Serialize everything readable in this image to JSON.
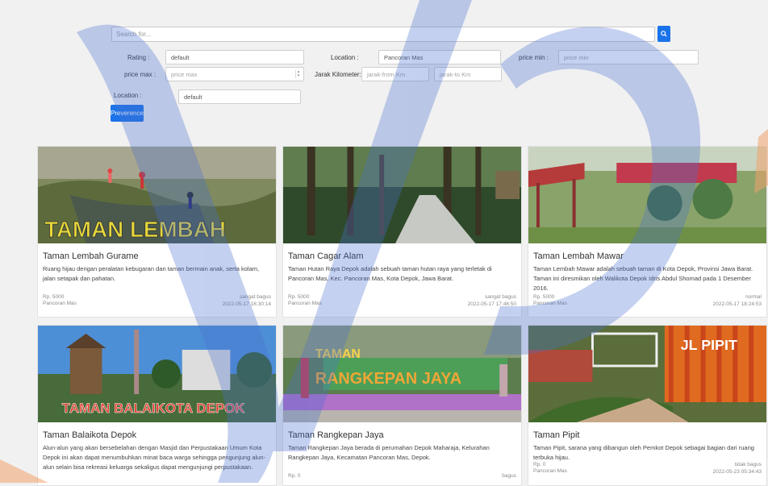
{
  "search": {
    "placeholder": "Search for..."
  },
  "filters": {
    "rating_label": "Rating :",
    "rating_value": "default",
    "location_label": "Location :",
    "location_value": "Pancoran Mas",
    "price_min_label": "price min :",
    "price_min_placeholder": "price min",
    "price_max_label": "price max :",
    "price_max_placeholder": "price max",
    "jarak_label": "Jarak Kilometer:",
    "jarak_from_placeholder": "jarak-from Km",
    "jarak_to_placeholder": "jarak-to Km",
    "location2_label": "Location :",
    "location2_value": "default",
    "preverence_label": "Preverence"
  },
  "cards": [
    {
      "title": "Taman Lembah Gurame",
      "desc": "Ruang hijau dengan peralatan kebugaran dan taman bermain anak, serta kolam, jalan setapak dan pahatan.",
      "price": "Rp. 5000",
      "location": "Pancoran Mas",
      "rating": "sangat bagus",
      "date": "2022-05-17 16:30:14",
      "photo_text": "TAMAN LEMBAH"
    },
    {
      "title": "Taman Cagar Alam",
      "desc": "Taman Hutan Raya Depok adalah sebuah taman hutan raya yang terletak di Pancoran Mas, Kec. Pancoran Mas, Kota Depok, Jawa Barat.",
      "price": "Rp. 5000",
      "location": "Pancoran Mas",
      "rating": "sangat bagus",
      "date": "2022-05-17 17:46:50",
      "photo_text": ""
    },
    {
      "title": "Taman Lembah Mawar",
      "desc": "Taman Lembah Mawar adalah sebuah taman di Kota Depok, Provinsi Jawa Barat. Taman ini diresmikan oleh Walikota Depok Idris Abdul Shomad pada 1 Desember 2016.",
      "price": "Rp. 5000",
      "location": "Pancoran Mas",
      "rating": "normal",
      "date": "2022-05-17 18:24:53",
      "photo_text": ""
    },
    {
      "title": "Taman Balaikota Depok",
      "desc": "Alun-alun yang akan bersebelahan dengan Masjid dan Perpustakaan Umum Kota Depok ini akan dapat menumbuhkan minat baca warga sehingga pengunjung alun-alun selain bisa rekreasi keluarga sekaligus dapat mengunjungi perpustakaan.",
      "price": "",
      "location": "",
      "rating": "",
      "date": "",
      "photo_text": "TAMAN BALAIKOTA DEPOK"
    },
    {
      "title": "Taman Rangkepan Jaya",
      "desc": "Taman Rangkepan Jaya berada di perumahan Depok Maharaja, Kelurahan Rangkepan Jaya, Kecamatan Pancoran Mas, Depok.",
      "price": "Rp. 0",
      "location": "",
      "rating": "bagus",
      "date": "",
      "photo_text": "TAMAN RANGKEPAN JAYA"
    },
    {
      "title": "Taman Pipit",
      "desc": "Taman Pipit, sarana yang dibangun oleh Pemkot Depok sebagai bagian dari ruang terbuka hijau.",
      "price": "Rp. 0",
      "location": "Pancoran Mas",
      "rating": "tidak bagus",
      "date": "2022-05-23 05:34:43",
      "photo_text": "JL PIPIT"
    }
  ],
  "colors": {
    "accent": "#1a73e8",
    "watermark_blue": "#4a6fd0",
    "watermark_orange": "#f0a36b"
  }
}
